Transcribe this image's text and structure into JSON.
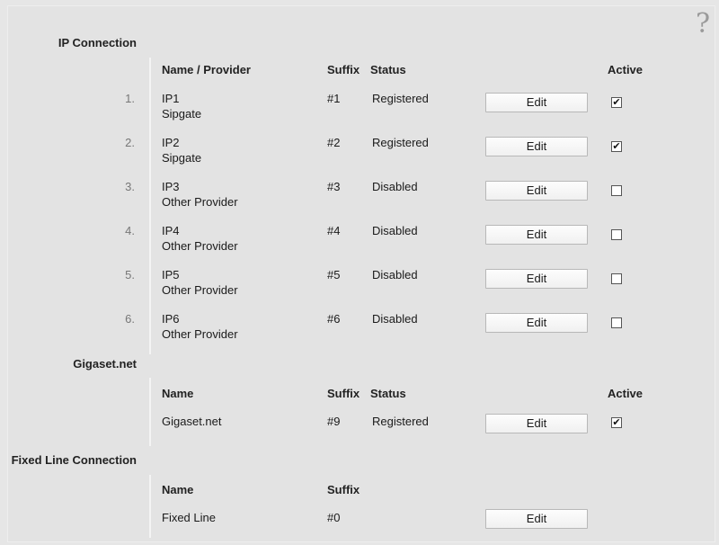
{
  "help": {
    "icon": "help-question-icon",
    "glyph": "?"
  },
  "ip": {
    "title": "IP Connection",
    "headers": {
      "name": "Name / Provider",
      "suffix": "Suffix",
      "status": "Status",
      "active": "Active"
    },
    "rows": [
      {
        "index": "1.",
        "name": "IP1",
        "provider": "Sipgate",
        "suffix": "#1",
        "status": "Registered",
        "edit": "Edit",
        "active": true
      },
      {
        "index": "2.",
        "name": "IP2",
        "provider": "Sipgate",
        "suffix": "#2",
        "status": "Registered",
        "edit": "Edit",
        "active": true
      },
      {
        "index": "3.",
        "name": "IP3",
        "provider": "Other Provider",
        "suffix": "#3",
        "status": "Disabled",
        "edit": "Edit",
        "active": false
      },
      {
        "index": "4.",
        "name": "IP4",
        "provider": "Other Provider",
        "suffix": "#4",
        "status": "Disabled",
        "edit": "Edit",
        "active": false
      },
      {
        "index": "5.",
        "name": "IP5",
        "provider": "Other Provider",
        "suffix": "#5",
        "status": "Disabled",
        "edit": "Edit",
        "active": false
      },
      {
        "index": "6.",
        "name": "IP6",
        "provider": "Other Provider",
        "suffix": "#6",
        "status": "Disabled",
        "edit": "Edit",
        "active": false
      }
    ]
  },
  "gigaset": {
    "title": "Gigaset.net",
    "headers": {
      "name": "Name",
      "suffix": "Suffix",
      "status": "Status",
      "active": "Active"
    },
    "row": {
      "name": "Gigaset.net",
      "suffix": "#9",
      "status": "Registered",
      "edit": "Edit",
      "active": true
    }
  },
  "fixed": {
    "title": "Fixed Line Connection",
    "headers": {
      "name": "Name",
      "suffix": "Suffix"
    },
    "row": {
      "name": "Fixed Line",
      "suffix": "#0",
      "edit": "Edit"
    }
  },
  "checkmark": "✔"
}
